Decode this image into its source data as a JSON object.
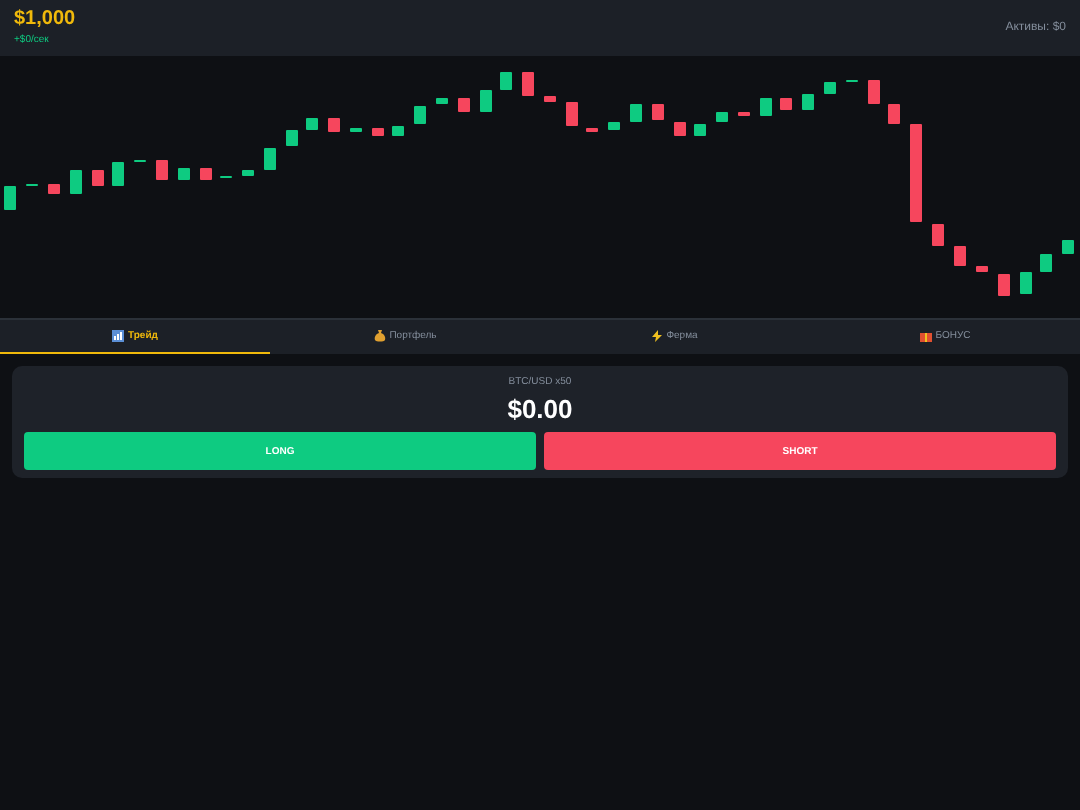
{
  "header": {
    "balance": "$1,000",
    "rate": "+$0/сек",
    "assets": "Активы: $0"
  },
  "tabs": [
    {
      "label": "Трейд",
      "selected": true
    },
    {
      "label": "Портфель",
      "selected": false
    },
    {
      "label": "Ферма",
      "selected": false
    },
    {
      "label": "БОНУС",
      "selected": false
    }
  ],
  "trade_card": {
    "pair": "BTC/USD x50",
    "pnl": "$0.00",
    "buttons": [
      {
        "label": "LONG",
        "kind": "long"
      },
      {
        "label": "SHORT",
        "kind": "short"
      }
    ]
  }
}
